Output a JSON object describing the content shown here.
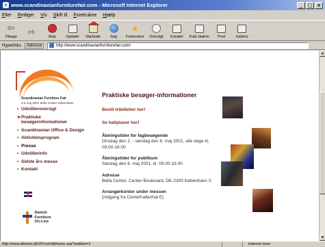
{
  "window": {
    "title": "www.scandinavianfurniturefair.com - Microsoft Internet Explorer",
    "app_icon": "ie-icon"
  },
  "menu": [
    "Filer",
    "Rediger",
    "Vis",
    "Skift til",
    "Foretrukne",
    "Hjælp"
  ],
  "toolbar": [
    {
      "label": "Tilbage",
      "icon": "back-icon"
    },
    {
      "label": "",
      "icon": "forward-icon"
    },
    {
      "label": "Stop",
      "icon": "stop-icon"
    },
    {
      "label": "Opdater",
      "icon": "refresh-icon"
    },
    {
      "label": "Startside",
      "icon": "home-icon"
    },
    {
      "label": "Søg",
      "icon": "search-icon"
    },
    {
      "label": "Foretrukne",
      "icon": "favorites-icon"
    },
    {
      "label": "Oversigt",
      "icon": "history-icon"
    },
    {
      "label": "Kanaler",
      "icon": "channels-icon"
    },
    {
      "label": "Fuld skærm",
      "icon": "fullscreen-icon"
    },
    {
      "label": "Post",
      "icon": "mail-icon"
    },
    {
      "label": "Udskriv",
      "icon": "print-icon"
    }
  ],
  "address": {
    "links_label": "Hyperlinks",
    "address_label": "Adresse",
    "url": "http://www.scandinavianfurniturefair.com/"
  },
  "logo": {
    "brand": "Scandinavian Furniture Fair",
    "subline": "2-6 maj 2001 Bella Center København"
  },
  "nav": [
    {
      "label": "Udstilleroversigt",
      "active": false
    },
    {
      "label": "Praktiske besøgerinformationer",
      "active": false
    },
    {
      "label": "Scandinavian Office & Design",
      "active": false
    },
    {
      "label": "Aktivitetsprogram",
      "active": false
    },
    {
      "label": "Presse",
      "active": true
    },
    {
      "label": "Udstillerinfo",
      "active": false
    },
    {
      "label": "Sidste års messe",
      "active": false
    },
    {
      "label": "Kontakt",
      "active": false
    }
  ],
  "dfo": {
    "line1": "Danish Furniture",
    "line2": "On-Line"
  },
  "main": {
    "heading": "Praktiske besøger-informationer",
    "link1": "Bestil tribilletter her!",
    "link2": "Se hallplaner her!",
    "sections": [
      {
        "heading": "Åbningstider for fagbesøgende",
        "body": "Onsdag den 2. - søndag den 6. maj 2001, alle dage kl. 09.00-18.00"
      },
      {
        "heading": "Åbningstider for publikum",
        "body": "Søndag den 6. maj 2001, kl. 09.00-18.00"
      },
      {
        "heading": "Adresse",
        "body": "Bella Center, Center Boulevard, DK-2300 København S"
      },
      {
        "heading": "Arrangørkontor under messen",
        "body": "(indgang fra Centerhallenhal E)"
      }
    ]
  },
  "status": {
    "url": "http://www.dkmain.dk/VFcom/dkframe.asp?sektion=1",
    "zone": "Internet zone"
  }
}
